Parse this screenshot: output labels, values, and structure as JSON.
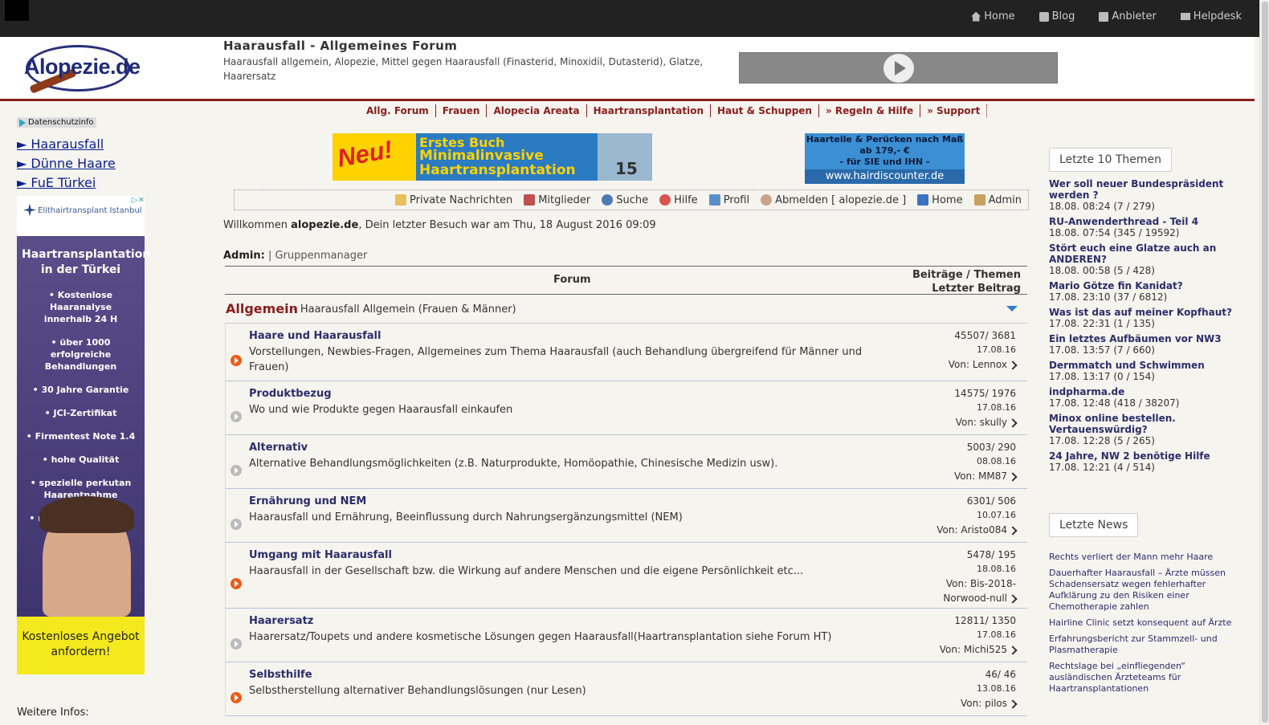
{
  "topnav": [
    {
      "label": "Home",
      "icon": "home-icon"
    },
    {
      "label": "Blog",
      "icon": "blog-icon"
    },
    {
      "label": "Anbieter",
      "icon": "list-icon"
    },
    {
      "label": "Helpdesk",
      "icon": "mail-icon"
    }
  ],
  "header": {
    "logo_text": "Alopezie.de",
    "title": "Haarausfall - Allgemeines Forum",
    "subtitle": "Haarausfall allgemein, Alopezie, Mittel gegen Haarausfall (Finasterid, Minoxidil, Dutasterid), Glatze, Haarersatz"
  },
  "mainnav": [
    "Allg. Forum",
    "Frauen",
    "Alopecia Areata",
    "Haartransplantation",
    "Haut & Schuppen",
    "» Regeln & Hilfe",
    "» Support"
  ],
  "left": {
    "privacy_label": "Datenschutzinfo",
    "links": [
      "► Haarausfall",
      "► Dünne Haare",
      "► FuE Türkei"
    ],
    "ad": {
      "brand": "Elithairtransplant Istanbul",
      "headline": "Haartransplantation in der Türkei",
      "bullets": [
        "• Kostenlose Haaranalyse innerhalb 24 H",
        "• über 1000 erfolgreiche Behandlungen",
        "• 30 Jahre Garantie",
        "• JCI-Zertifikat",
        "• Firmentest Note 1.4",
        "• hohe Qualität",
        "• spezielle perkutan Haarentnahme",
        "• modernste Technik"
      ],
      "cta": "Kostenloses Angebot anfordern!"
    },
    "more_info": "Weitere Infos:"
  },
  "banners": {
    "b1_neu": "Neu!",
    "b1_line1": "Erstes Buch",
    "b1_line2": "Minimalinvasive Haartransplantation",
    "b1_number": "15",
    "b2_line1": "Haarteile & Perücken nach Maß",
    "b2_line2": "ab 179,- €",
    "b2_line3": "- für SIE und IHN -",
    "b2_url": "www.hairdiscounter.de"
  },
  "userbar": [
    {
      "label": "Private Nachrichten",
      "icon": "envelope-icon",
      "color": "#e8c15a"
    },
    {
      "label": "Mitglieder",
      "icon": "members-icon",
      "color": "#c0504d"
    },
    {
      "label": "Suche",
      "icon": "search-icon",
      "color": "#4a7bb7"
    },
    {
      "label": "Hilfe",
      "icon": "help-icon",
      "color": "#d9534f"
    },
    {
      "label": "Profil",
      "icon": "profile-icon",
      "color": "#5b8fc9"
    },
    {
      "label": "Abmelden [ alopezie.de ]",
      "icon": "logout-icon",
      "color": "#c9a48a"
    },
    {
      "label": "Home",
      "icon": "home-icon",
      "color": "#3a73c0"
    },
    {
      "label": "Admin",
      "icon": "admin-icon",
      "color": "#c8a060"
    }
  ],
  "welcome": {
    "prefix": "Willkommen ",
    "user": "alopezie.de",
    "suffix": ", Dein letzter Besuch war am Thu, 18 August 2016 09:09"
  },
  "admin": {
    "label": "Admin:",
    "link": "| Gruppenmanager"
  },
  "forum": {
    "col_forum": "Forum",
    "col_stats_1": "Beiträge / Themen",
    "col_stats_2": "Letzter Beitrag",
    "category": {
      "name": "Allgemein",
      "desc": "- Haarausfall Allgemein (Frauen & Männer)"
    },
    "rows": [
      {
        "title": "Haare und Haarausfall",
        "desc": "Vorstellungen, Newbies-Fragen, Allgemeines zum Thema Haarausfall (auch Behandlung übergreifend für Männer und Frauen)",
        "counts": "45507/ 3681",
        "date": "17.08.16",
        "by": "Von: Lennox",
        "new": true
      },
      {
        "title": "Produktbezug",
        "desc": "Wo und wie Produkte gegen Haarausfall einkaufen",
        "counts": "14575/ 1976",
        "date": "17.08.16",
        "by": "Von: skully",
        "new": false
      },
      {
        "title": "Alternativ",
        "desc": "Alternative Behandlungsmöglichkeiten (z.B. Naturprodukte, Homöopathie, Chinesische Medizin usw).",
        "counts": "5003/ 290",
        "date": "08.08.16",
        "by": "Von: MM87",
        "new": false
      },
      {
        "title": "Ernährung und NEM",
        "desc": "Haarausfall und Ernährung, Beeinflussung durch Nahrungsergänzungsmittel (NEM)",
        "counts": "6301/ 506",
        "date": "10.07.16",
        "by": "Von: Aristo084",
        "new": false
      },
      {
        "title": "Umgang mit Haarausfall",
        "desc": "Haarausfall in der Gesellschaft bzw. die Wirkung auf andere Menschen und die eigene Persönlichkeit etc...",
        "counts": "5478/ 195",
        "date": "18.08.16",
        "by": "Von: Bis-2018-Norwood-null",
        "new": true
      },
      {
        "title": "Haarersatz",
        "desc": "Haarersatz/Toupets und andere kosmetische Lösungen gegen Haarausfall(Haartransplantation siehe Forum HT)",
        "counts": "12811/ 1350",
        "date": "17.08.16",
        "by": "Von: Michi525",
        "new": false
      },
      {
        "title": "Selbsthilfe",
        "desc": "Selbstherstellung alternativer Behandlungslösungen (nur Lesen)",
        "counts": "46/ 46",
        "date": "13.08.16",
        "by": "Von: pilos",
        "new": true
      }
    ]
  },
  "right": {
    "topics_title": "Letzte 10 Themen",
    "topics": [
      {
        "t": "Wer soll neuer Bundespräsident werden ?",
        "m": "18.08. 08:24 (7 / 279)"
      },
      {
        "t": "RU-Anwenderthread - Teil 4",
        "m": "18.08. 07:54 (345 / 19592)"
      },
      {
        "t": "Stört euch eine Glatze auch an ANDEREN?",
        "m": "18.08. 00:58 (5 / 428)"
      },
      {
        "t": "Mario Götze fin Kanidat?",
        "m": "17.08. 23:10 (37 / 6812)"
      },
      {
        "t": "Was ist das auf meiner Kopfhaut?",
        "m": "17.08. 22:31 (1 / 135)"
      },
      {
        "t": "Ein letztes Aufbäumen vor NW3",
        "m": "17.08. 13:57 (7 / 660)"
      },
      {
        "t": "Dermmatch und Schwimmen",
        "m": "17.08. 13:17 (0 / 154)"
      },
      {
        "t": "indpharma.de",
        "m": "17.08. 12:48 (418 / 38207)"
      },
      {
        "t": "Minox online bestellen. Vertauenswürdig?",
        "m": "17.08. 12:28 (5 / 265)"
      },
      {
        "t": "24 Jahre, NW 2 benötige Hilfe",
        "m": "17.08. 12:21 (4 / 514)"
      }
    ],
    "news_title": "Letzte News",
    "news": [
      "Rechts verliert der Mann mehr Haare",
      "Dauerhafter Haarausfall – Ärzte müssen Schadensersatz wegen fehlerhafter Aufklärung zu den Risiken einer Chemotherapie zahlen",
      "Hairline Clinic setzt konsequent auf Ärzte",
      "Erfahrungsbericht zur Stammzell- und Plasmatherapie",
      "Rechtslage bei „einfliegenden“ ausländischen Ärzteteams für Haartransplantationen"
    ]
  }
}
